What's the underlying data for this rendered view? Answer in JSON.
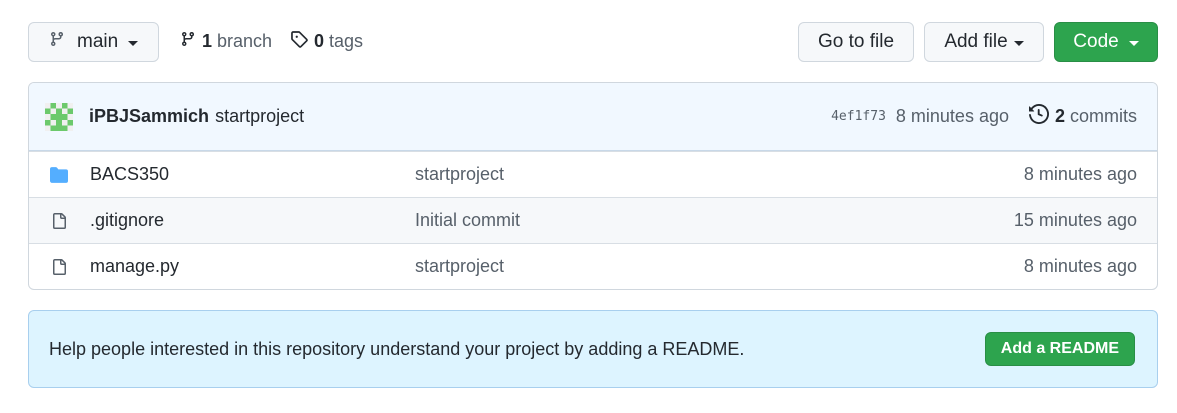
{
  "toolbar": {
    "branch_name": "main",
    "branch_count": "1",
    "branch_label": "branch",
    "tag_count": "0",
    "tag_label": "tags",
    "go_to_file": "Go to file",
    "add_file": "Add file",
    "code": "Code"
  },
  "latest_commit": {
    "author": "iPBJSammich",
    "message": "startproject",
    "sha": "4ef1f73",
    "age": "8 minutes ago",
    "commit_count": "2",
    "commit_label": "commits"
  },
  "files": [
    {
      "icon": "folder-icon",
      "name": "BACS350",
      "commit": "startproject",
      "age": "8 minutes ago"
    },
    {
      "icon": "file-icon",
      "name": ".gitignore",
      "commit": "Initial commit",
      "age": "15 minutes ago"
    },
    {
      "icon": "file-icon",
      "name": "manage.py",
      "commit": "startproject",
      "age": "8 minutes ago"
    }
  ],
  "readme_banner": {
    "text": "Help people interested in this repository understand your project by adding a README.",
    "button": "Add a README"
  },
  "colors": {
    "primary_green": "#2da44e",
    "folder_blue": "#54aeff",
    "banner_bg": "#ddf4ff"
  }
}
